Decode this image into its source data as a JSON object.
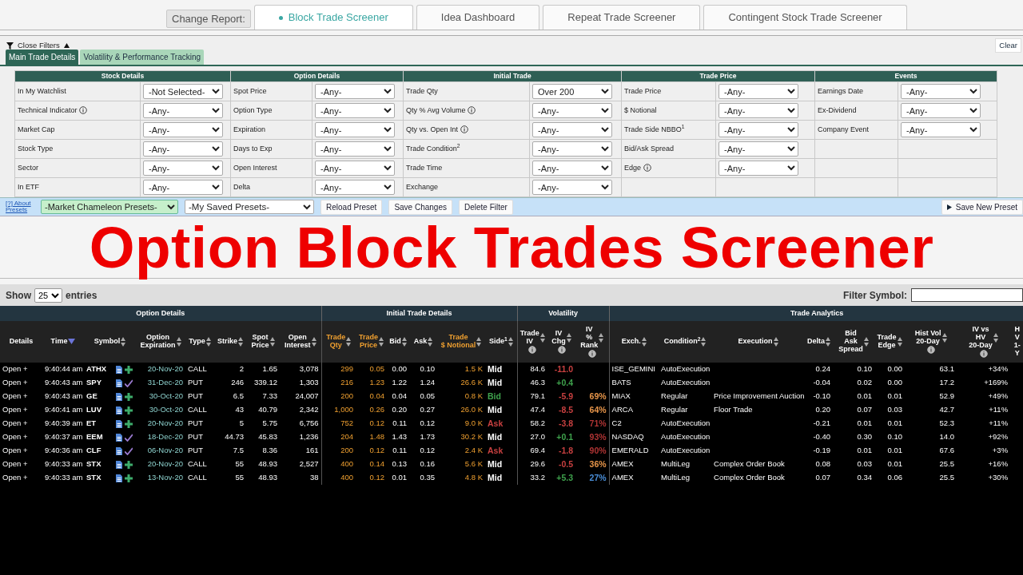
{
  "change_report_label": "Change Report:",
  "report_tabs": [
    {
      "label": "Block Trade Screener",
      "selected": true
    },
    {
      "label": "Idea Dashboard",
      "selected": false
    },
    {
      "label": "Repeat Trade Screener",
      "selected": false
    },
    {
      "label": "Contingent Stock Trade Screener",
      "selected": false
    }
  ],
  "filters_toggle": "Close Filters",
  "expanded": true,
  "clear_button": "Clear",
  "filter_tabs": [
    {
      "label": "Main Trade Details",
      "selected": true
    },
    {
      "label": "Volatility & Performance Tracking",
      "selected": false
    }
  ],
  "filter_groups": [
    {
      "title": "Stock Details",
      "filters": [
        {
          "label": "In My Watchlist",
          "value": "-Not Selected-",
          "info": false
        },
        {
          "label": "Technical Indicator",
          "value": "-Any-",
          "info": true
        },
        {
          "label": "Market Cap",
          "value": "-Any-",
          "info": false
        },
        {
          "label": "Stock Type",
          "value": "-Any-",
          "info": false
        },
        {
          "label": "Sector",
          "value": "-Any-",
          "info": false
        },
        {
          "label": "In ETF",
          "value": "-Any-",
          "info": false
        }
      ]
    },
    {
      "title": "Option Details",
      "filters": [
        {
          "label": "Spot Price",
          "value": "-Any-",
          "info": false
        },
        {
          "label": "Option Type",
          "value": "-Any-",
          "info": false
        },
        {
          "label": "Expiration",
          "value": "-Any-",
          "info": false
        },
        {
          "label": "Days to Exp",
          "value": "-Any-",
          "info": false
        },
        {
          "label": "Open Interest",
          "value": "-Any-",
          "info": false
        },
        {
          "label": "Delta",
          "value": "-Any-",
          "info": false
        }
      ]
    },
    {
      "title": "Initial Trade",
      "filters": [
        {
          "label": "Trade Qty",
          "value": "Over 200",
          "info": false
        },
        {
          "label": "Qty % Avg Volume",
          "value": "-Any-",
          "info": true
        },
        {
          "label": "Qty vs. Open Int",
          "value": "-Any-",
          "info": true
        },
        {
          "label": "Trade Condition$^{2}$",
          "value": "-Any-",
          "info": false
        },
        {
          "label": "Trade Time",
          "value": "-Any-",
          "info": false
        },
        {
          "label": "Exchange",
          "value": "-Any-",
          "info": false
        }
      ]
    },
    {
      "title": "Trade Price",
      "filters": [
        {
          "label": "Trade Price",
          "value": "-Any-",
          "info": false
        },
        {
          "label": "$ Notional",
          "value": "-Any-",
          "info": false
        },
        {
          "label": "Trade Side NBBO$^{1}$",
          "value": "-Any-",
          "info": false
        },
        {
          "label": "Bid/Ask Spread",
          "value": "-Any-",
          "info": false
        },
        {
          "label": "Edge",
          "value": "-Any-",
          "info": true
        }
      ]
    },
    {
      "title": "Events",
      "filters": [
        {
          "label": "Earnings Date",
          "value": "-Any-",
          "info": false
        },
        {
          "label": "Ex-Dividend",
          "value": "-Any-",
          "info": false
        },
        {
          "label": "Company Event",
          "value": "-Any-",
          "info": false
        }
      ]
    }
  ],
  "presets": {
    "about_link": "[?] About Presets",
    "market_presets": "-Market Chameleon Presets-",
    "my_presets": "-My Saved Presets-",
    "buttons": [
      "Reload Preset",
      "Save Changes",
      "Delete Filter"
    ],
    "save_new": "Save New Preset"
  },
  "overlay_title": "Option Block Trades Screener",
  "show_label": "Show",
  "page_size": "25",
  "entries_label": "entries",
  "filter_symbol_label": "Filter Symbol:",
  "column_groups": [
    {
      "title": "Option Details",
      "columns": [
        {
          "label": "Details",
          "kind": "plain",
          "highlight": false,
          "info": false
        },
        {
          "label": "Time",
          "kind": "sorted",
          "highlight": false,
          "info": false
        },
        {
          "label": "Symbol",
          "kind": "sortable",
          "highlight": false,
          "info": false
        },
        {
          "label": "Option\nExpiration",
          "kind": "sortable",
          "highlight": false,
          "info": false
        },
        {
          "label": "Type",
          "kind": "sortable",
          "highlight": false,
          "info": false
        },
        {
          "label": "Strike",
          "kind": "sortable",
          "highlight": false,
          "info": false
        },
        {
          "label": "Spot\nPrice",
          "kind": "sortable",
          "highlight": false,
          "info": false
        },
        {
          "label": "Open\nInterest",
          "kind": "sortable",
          "highlight": false,
          "info": false
        }
      ]
    },
    {
      "title": "Initial Trade Details",
      "columns": [
        {
          "label": "Trade\nQty",
          "kind": "sortable",
          "highlight": true,
          "info": false
        },
        {
          "label": "Trade\nPrice",
          "kind": "sortable",
          "highlight": true,
          "info": false
        },
        {
          "label": "Bid",
          "kind": "sortable",
          "highlight": false,
          "info": false
        },
        {
          "label": "Ask",
          "kind": "sortable",
          "highlight": false,
          "info": false
        },
        {
          "label": "Trade\n$ Notional",
          "kind": "sortable",
          "highlight": true,
          "info": false
        },
        {
          "label": "Side$^{1}$",
          "kind": "sortable",
          "highlight": false,
          "info": false
        }
      ]
    },
    {
      "title": "Volatility",
      "columns": [
        {
          "label": "Trade\nIV",
          "kind": "sortable",
          "highlight": false,
          "info": true
        },
        {
          "label": "IV\nChg",
          "kind": "sortable",
          "highlight": false,
          "info": true
        },
        {
          "label": "IV\n%\nRank",
          "kind": "sortable",
          "highlight": false,
          "info": true
        }
      ]
    },
    {
      "title": "Trade Analytics",
      "columns": [
        {
          "label": "Exch.",
          "kind": "sortable",
          "highlight": false,
          "info": false
        },
        {
          "label": "Condition$^{2}$",
          "kind": "sortable",
          "highlight": false,
          "info": false
        },
        {
          "label": "Execution",
          "kind": "sortable",
          "highlight": false,
          "info": false
        },
        {
          "label": "Delta",
          "kind": "sortable",
          "highlight": false,
          "info": false
        },
        {
          "label": "Bid\nAsk\nSpread",
          "kind": "sortable",
          "highlight": false,
          "info": false
        },
        {
          "label": "Trade\nEdge",
          "kind": "sortable",
          "highlight": false,
          "info": false
        },
        {
          "label": "Hist Vol\n20-Day",
          "kind": "sortable",
          "highlight": false,
          "info": true
        },
        {
          "label": "IV vs\nHV\n20-Day",
          "kind": "sortable",
          "highlight": false,
          "info": true
        },
        {
          "label": "H\nV\n1-Y",
          "kind": "plain",
          "highlight": false,
          "info": false
        }
      ]
    }
  ],
  "rows": [
    {
      "details": "Open +",
      "time": "9:40:44 am",
      "symbol": "ATHX",
      "kind": "plus",
      "expiration": "20-Nov-20",
      "type": "CALL",
      "strike": "2",
      "spot": "1.65",
      "open_interest": "3,078",
      "trade_qty": "299",
      "trade_price": "0.05",
      "bid": "0.00",
      "ask": "0.10",
      "notional": "1.5 K",
      "side": {
        "text": "Mid",
        "color": "#ffffff"
      },
      "trade_iv": "84.6",
      "iv_chg": {
        "text": "-11.0",
        "color": "#c84040"
      },
      "exch": "ISE_GEMINI",
      "condition": "AutoExecution",
      "delta": "0.24",
      "spread": "0.10",
      "edge": "0.00",
      "hist_vol": "63.1",
      "iv_vs_hv": "+34%"
    },
    {
      "details": "Open +",
      "time": "9:40:43 am",
      "symbol": "SPY",
      "kind": "check",
      "expiration": "31-Dec-20",
      "type": "PUT",
      "strike": "246",
      "spot": "339.12",
      "open_interest": "1,303",
      "trade_qty": "216",
      "trade_price": "1.23",
      "bid": "1.22",
      "ask": "1.24",
      "notional": "26.6 K",
      "side": {
        "text": "Mid",
        "color": "#ffffff"
      },
      "trade_iv": "46.3",
      "iv_chg": {
        "text": "+0.4",
        "color": "#3fa34d"
      },
      "exch": "BATS",
      "condition": "AutoExecution",
      "delta": "-0.04",
      "spread": "0.02",
      "edge": "0.00",
      "hist_vol": "17.2",
      "iv_vs_hv": "+169%"
    },
    {
      "details": "Open +",
      "time": "9:40:43 am",
      "symbol": "GE",
      "kind": "plus",
      "expiration": "30-Oct-20",
      "type": "PUT",
      "strike": "6.5",
      "spot": "7.33",
      "open_interest": "24,007",
      "trade_qty": "200",
      "trade_price": "0.04",
      "bid": "0.04",
      "ask": "0.05",
      "notional": "0.8 K",
      "side": {
        "text": "Bid",
        "color": "#3fa34d"
      },
      "trade_iv": "79.1",
      "iv_chg": {
        "text": "-5.9",
        "color": "#c84040"
      },
      "iv_rank": {
        "text": "69%",
        "color": "#e8964a"
      },
      "exch": "MIAX",
      "condition": "Regular",
      "execution": "Price Improvement Auction",
      "delta": "-0.10",
      "spread": "0.01",
      "edge": "0.01",
      "hist_vol": "52.9",
      "iv_vs_hv": "+49%"
    },
    {
      "details": "Open +",
      "time": "9:40:41 am",
      "symbol": "LUV",
      "kind": "plus",
      "expiration": "30-Oct-20",
      "type": "CALL",
      "strike": "43",
      "spot": "40.79",
      "open_interest": "2,342",
      "trade_qty": "1,000",
      "trade_price": "0.26",
      "bid": "0.20",
      "ask": "0.27",
      "notional": "26.0 K",
      "side": {
        "text": "Mid",
        "color": "#ffffff"
      },
      "trade_iv": "47.4",
      "iv_chg": {
        "text": "-8.5",
        "color": "#c84040"
      },
      "iv_rank": {
        "text": "64%",
        "color": "#e8964a"
      },
      "exch": "ARCA",
      "condition": "Regular",
      "execution": "Floor Trade",
      "delta": "0.20",
      "spread": "0.07",
      "edge": "0.03",
      "hist_vol": "42.7",
      "iv_vs_hv": "+11%"
    },
    {
      "details": "Open +",
      "time": "9:40:39 am",
      "symbol": "ET",
      "kind": "plus",
      "expiration": "20-Nov-20",
      "type": "PUT",
      "strike": "5",
      "spot": "5.75",
      "open_interest": "6,756",
      "trade_qty": "752",
      "trade_price": "0.12",
      "bid": "0.11",
      "ask": "0.12",
      "notional": "9.0 K",
      "side": {
        "text": "Ask",
        "color": "#c84040"
      },
      "trade_iv": "58.2",
      "iv_chg": {
        "text": "-3.8",
        "color": "#c84040"
      },
      "iv_rank": {
        "text": "71%",
        "color": "#b03434"
      },
      "exch": "C2",
      "condition": "AutoExecution",
      "delta": "-0.21",
      "spread": "0.01",
      "edge": "0.01",
      "hist_vol": "52.3",
      "iv_vs_hv": "+11%"
    },
    {
      "details": "Open +",
      "time": "9:40:37 am",
      "symbol": "EEM",
      "kind": "check",
      "expiration": "18-Dec-20",
      "type": "PUT",
      "strike": "44.73",
      "spot": "45.83",
      "open_interest": "1,236",
      "trade_qty": "204",
      "trade_price": "1.48",
      "bid": "1.43",
      "ask": "1.73",
      "notional": "30.2 K",
      "side": {
        "text": "Mid",
        "color": "#ffffff"
      },
      "trade_iv": "27.0",
      "iv_chg": {
        "text": "+0.1",
        "color": "#3fa34d"
      },
      "iv_rank": {
        "text": "93%",
        "color": "#b03434"
      },
      "exch": "NASDAQ",
      "condition": "AutoExecution",
      "delta": "-0.40",
      "spread": "0.30",
      "edge": "0.10",
      "hist_vol": "14.0",
      "iv_vs_hv": "+92%"
    },
    {
      "details": "Open +",
      "time": "9:40:36 am",
      "symbol": "CLF",
      "kind": "check",
      "expiration": "06-Nov-20",
      "type": "PUT",
      "strike": "7.5",
      "spot": "8.36",
      "open_interest": "161",
      "trade_qty": "200",
      "trade_price": "0.12",
      "bid": "0.11",
      "ask": "0.12",
      "notional": "2.4 K",
      "side": {
        "text": "Ask",
        "color": "#c84040"
      },
      "trade_iv": "69.4",
      "iv_chg": {
        "text": "-1.8",
        "color": "#c84040"
      },
      "iv_rank": {
        "text": "90%",
        "color": "#b03434"
      },
      "exch": "EMERALD",
      "condition": "AutoExecution",
      "delta": "-0.19",
      "spread": "0.01",
      "edge": "0.01",
      "hist_vol": "67.6",
      "iv_vs_hv": "+3%"
    },
    {
      "details": "Open +",
      "time": "9:40:33 am",
      "symbol": "STX",
      "kind": "plus",
      "expiration": "20-Nov-20",
      "type": "CALL",
      "strike": "55",
      "spot": "48.93",
      "open_interest": "2,527",
      "trade_qty": "400",
      "trade_price": "0.14",
      "bid": "0.13",
      "ask": "0.16",
      "notional": "5.6 K",
      "side": {
        "text": "Mid",
        "color": "#ffffff"
      },
      "trade_iv": "29.6",
      "iv_chg": {
        "text": "-0.5",
        "color": "#c84040"
      },
      "iv_rank": {
        "text": "36%",
        "color": "#e8964a"
      },
      "exch": "AMEX",
      "condition": "MultiLeg",
      "execution": "Complex Order Book",
      "delta": "0.08",
      "spread": "0.03",
      "edge": "0.01",
      "hist_vol": "25.5",
      "iv_vs_hv": "+16%"
    },
    {
      "details": "Open +",
      "time": "9:40:33 am",
      "symbol": "STX",
      "kind": "plus",
      "expiration": "13-Nov-20",
      "type": "CALL",
      "strike": "55",
      "spot": "48.93",
      "open_interest": "38",
      "trade_qty": "400",
      "trade_price": "0.12",
      "bid": "0.01",
      "ask": "0.35",
      "notional": "4.8 K",
      "side": {
        "text": "Mid",
        "color": "#ffffff"
      },
      "trade_iv": "33.2",
      "iv_chg": {
        "text": "+5.3",
        "color": "#3fa34d"
      },
      "iv_rank": {
        "text": "27%",
        "color": "#4a8fd9"
      },
      "exch": "AMEX",
      "condition": "MultiLeg",
      "execution": "Complex Order Book",
      "delta": "0.07",
      "spread": "0.34",
      "edge": "0.06",
      "hist_vol": "25.5",
      "iv_vs_hv": "+30%"
    }
  ]
}
